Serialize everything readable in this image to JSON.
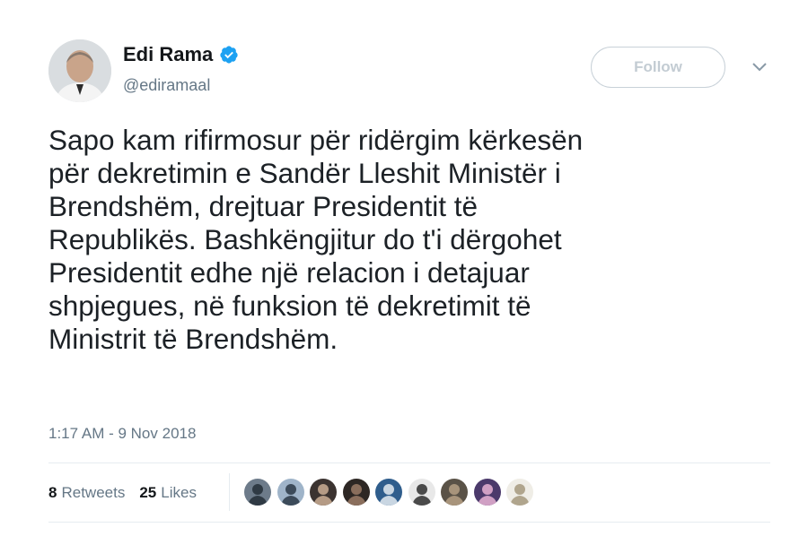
{
  "author": {
    "display_name": "Edi Rama",
    "handle": "@ediramaal",
    "verified": true
  },
  "follow_button": {
    "label": "Follow"
  },
  "tweet": {
    "text": "Sapo kam rifirmosur për ridërgim kërkesën\npër dekretimin e Sandër Lleshit Ministër i\nBrendshëm, drejtuar Presidentit të\nRepublikës. Bashkëngjitur do t'i dërgohet\nPresidentit edhe një relacion i detajuar\nshpjegues, në funksion të dekretimit të\nMinistrit të Brendshëm.",
    "timestamp": "1:17 AM - 9 Nov 2018"
  },
  "stats": {
    "retweets_count": "8",
    "retweets_label": "Retweets",
    "likes_count": "25",
    "likes_label": "Likes"
  },
  "likers": [
    {
      "bg": "#6d7b8a",
      "fg": "#2f3a44"
    },
    {
      "bg": "#9fb4c9",
      "fg": "#3c4b5a"
    },
    {
      "bg": "#3b3330",
      "fg": "#b59b85"
    },
    {
      "bg": "#2d2724",
      "fg": "#8a6e5c"
    },
    {
      "bg": "#2f5d8c",
      "fg": "#c9d6e2"
    },
    {
      "bg": "#e8e8e8",
      "fg": "#4a4a4a"
    },
    {
      "bg": "#5a5247",
      "fg": "#a8947b"
    },
    {
      "bg": "#4b3a6b",
      "fg": "#d0a0c4"
    },
    {
      "bg": "#efede6",
      "fg": "#b0a58d"
    }
  ],
  "colors": {
    "verified_badge": "#1da1f2",
    "text_primary": "#14171a",
    "text_secondary": "#657786",
    "border": "#e6ecf0"
  },
  "icons": {
    "verified": "verified-badge-icon",
    "caret": "chevron-down-icon"
  }
}
